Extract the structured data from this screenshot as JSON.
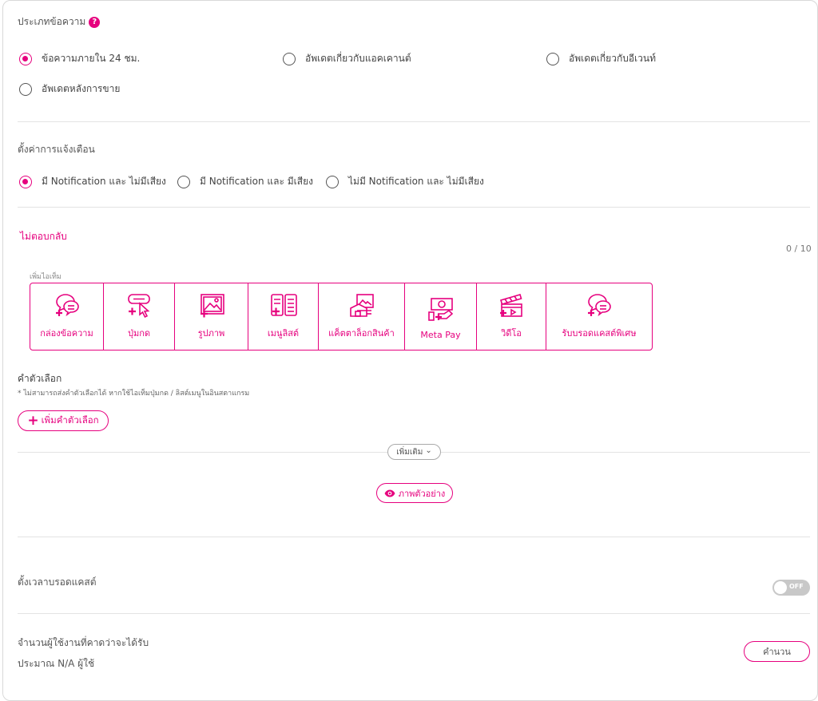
{
  "message_type": {
    "label": "ประเภทข้อความ",
    "help": "?",
    "options": [
      {
        "label": "ข้อความภายใน 24 ชม.",
        "selected": true
      },
      {
        "label": "อัพเดตเกี่ยวกับแอคเคานต์",
        "selected": false
      },
      {
        "label": "อัพเดตเกี่ยวกับอีเวนท์",
        "selected": false
      },
      {
        "label": "อัพเดตหลังการขาย",
        "selected": false
      }
    ]
  },
  "notification": {
    "label": "ตั้งค่าการแจ้งเตือน",
    "options": [
      {
        "label": "มี Notification และ ไม่มีเสียง",
        "selected": true
      },
      {
        "label": "มี Notification และ มีเสียง",
        "selected": false
      },
      {
        "label": "ไม่มี Notification และ ไม่มีเสียง",
        "selected": false
      }
    ]
  },
  "reply": {
    "title": "ไม่ตอบกลับ",
    "counter": "0 / 10",
    "add_items_label": "เพิ่มไอเท็ม",
    "tools": [
      {
        "icon": "message-box-icon",
        "label": "กล่องข้อความ"
      },
      {
        "icon": "button-icon",
        "label": "ปุ่มกด"
      },
      {
        "icon": "image-icon",
        "label": "รูปภาพ"
      },
      {
        "icon": "menu-list-icon",
        "label": "เมนูลิสต์"
      },
      {
        "icon": "product-catalog-icon",
        "label": "แค็ตตาล็อกสินค้า"
      },
      {
        "icon": "meta-pay-icon",
        "label": "Meta Pay"
      },
      {
        "icon": "video-icon",
        "label": "วิดีโอ"
      },
      {
        "icon": "special-broadcast-icon",
        "label": "รับบรอดแคสต์พิเศษ"
      }
    ]
  },
  "quick_reply": {
    "title": "คำตัวเลือก",
    "note": "* ไม่สามารถส่งคำตัวเลือกได้ หากใช้ไอเท็มปุ่มกด / ลิสต์เมนูในอินสตาแกรม",
    "add_button": "เพิ่มคำตัวเลือก",
    "add_icon": "+"
  },
  "more_button": "เพิ่มเติม",
  "more_chevron": "⌄",
  "preview_button": "ภาพตัวอย่าง",
  "schedule": {
    "label": "ตั้งเวลาบรอดแคสต์",
    "toggle_text": "OFF",
    "enabled": false
  },
  "estimate": {
    "label": "จำนวนผู้ใช้งานที่คาดว่าจะได้รับ",
    "value": "ประมาณ N/A ผู้ใช้",
    "button": "คำนวน"
  },
  "colors": {
    "accent": "#e6007e",
    "divider": "#e3e3e3",
    "toggle_off": "#c8c8c8"
  }
}
